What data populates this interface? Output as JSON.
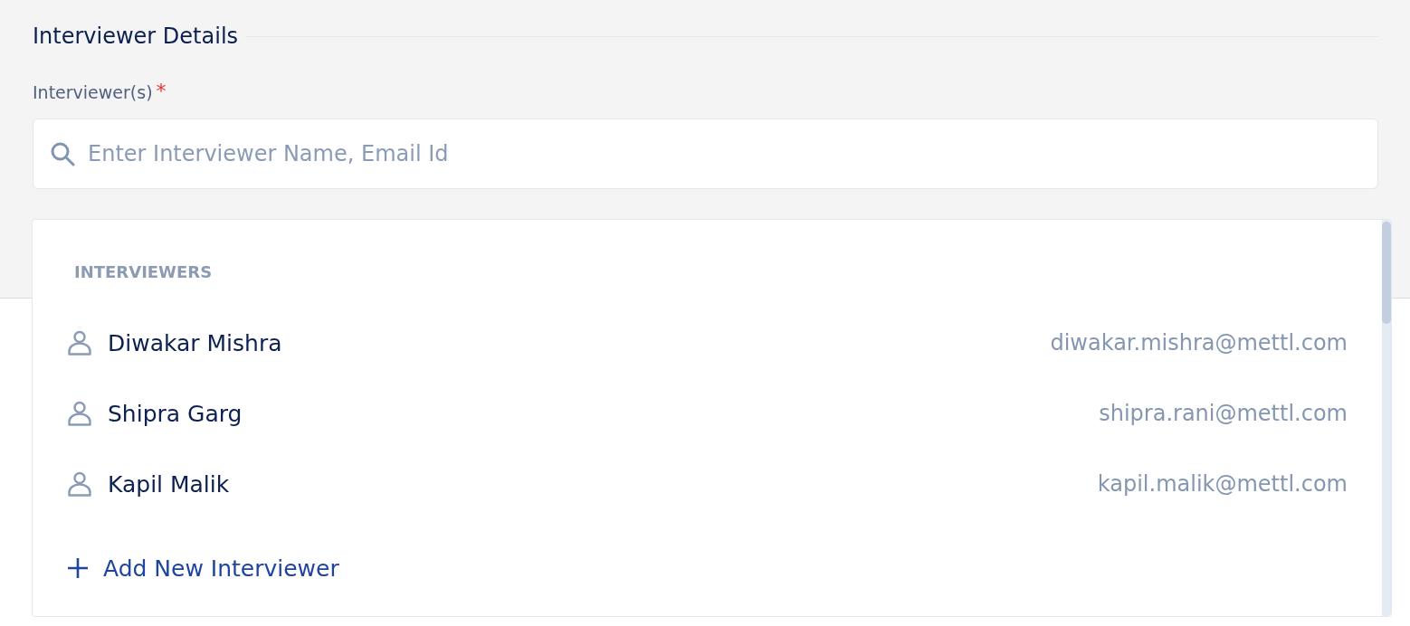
{
  "section": {
    "title": "Interviewer Details"
  },
  "field": {
    "label": "Interviewer(s)",
    "required_mark": "*",
    "placeholder": "Enter Interviewer Name, Email Id"
  },
  "dropdown": {
    "group_label": "INTERVIEWERS",
    "options": [
      {
        "name": "Diwakar Mishra",
        "email": "diwakar.mishra@mettl.com",
        "selected": false
      },
      {
        "name": "Shipra Garg",
        "email": "shipra.rani@mettl.com",
        "selected": false
      },
      {
        "name": "Kapil Malik",
        "email": "kapil.malik@mettl.com",
        "selected": false
      }
    ],
    "add_action": "Add New Interviewer"
  }
}
